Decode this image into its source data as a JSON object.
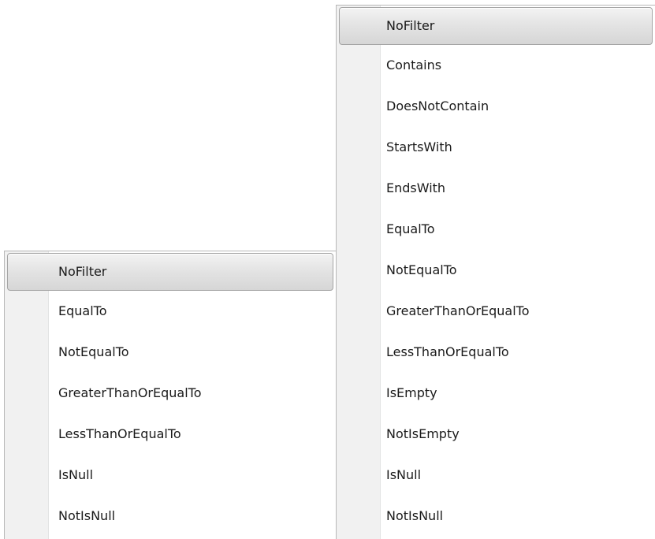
{
  "menu_left": {
    "items": [
      {
        "label": "NoFilter",
        "selected": true
      },
      {
        "label": "EqualTo"
      },
      {
        "label": "NotEqualTo"
      },
      {
        "label": "GreaterThanOrEqualTo"
      },
      {
        "label": "LessThanOrEqualTo"
      },
      {
        "label": "IsNull"
      },
      {
        "label": "NotIsNull"
      }
    ]
  },
  "menu_right": {
    "items": [
      {
        "label": "NoFilter",
        "selected": true
      },
      {
        "label": "Contains"
      },
      {
        "label": "DoesNotContain"
      },
      {
        "label": "StartsWith"
      },
      {
        "label": "EndsWith"
      },
      {
        "label": "EqualTo"
      },
      {
        "label": "NotEqualTo"
      },
      {
        "label": "GreaterThanOrEqualTo"
      },
      {
        "label": "LessThanOrEqualTo"
      },
      {
        "label": "IsEmpty"
      },
      {
        "label": "NotIsEmpty"
      },
      {
        "label": "IsNull"
      },
      {
        "label": "NotIsNull"
      }
    ]
  }
}
